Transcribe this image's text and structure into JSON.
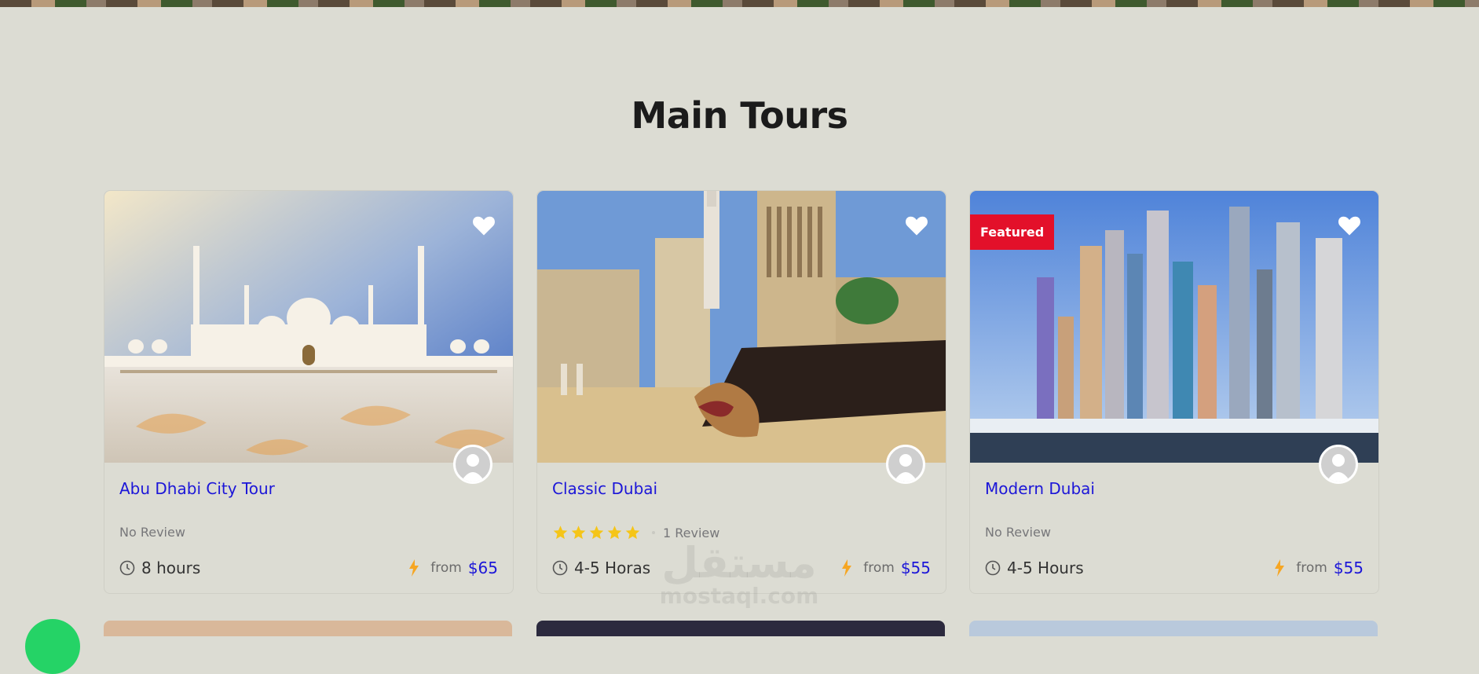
{
  "section": {
    "title": "Main Tours"
  },
  "tours": [
    {
      "title": "Abu Dhabi City Tour",
      "review_text": "No Review",
      "rating": null,
      "duration": "8 hours",
      "from_label": "from",
      "price": "$65",
      "featured": false,
      "image": "sheikh-zayed-grand-mosque"
    },
    {
      "title": "Classic Dubai",
      "review_text": "1 Review",
      "rating": 5,
      "duration": "4-5 Horas",
      "from_label": "from",
      "price": "$55",
      "featured": false,
      "image": "al-fahidi-historical-district"
    },
    {
      "title": "Modern Dubai",
      "review_text": "No Review",
      "rating": null,
      "duration": "4-5 Hours",
      "from_label": "from",
      "price": "$55",
      "featured": true,
      "featured_label": "Featured",
      "image": "dubai-marina-skyline"
    }
  ],
  "watermark": {
    "arabic": "مستقل",
    "latin": "mostaql.com"
  },
  "colors": {
    "background": "#dcdcd3",
    "link": "#1c16d8",
    "featured_badge": "#e3102a",
    "star": "#f5c518",
    "bolt": "#f6a623",
    "chat": "#25d366"
  },
  "icons": [
    "heart-icon",
    "user-avatar-icon",
    "star-icon",
    "clock-icon",
    "lightning-bolt-icon"
  ]
}
